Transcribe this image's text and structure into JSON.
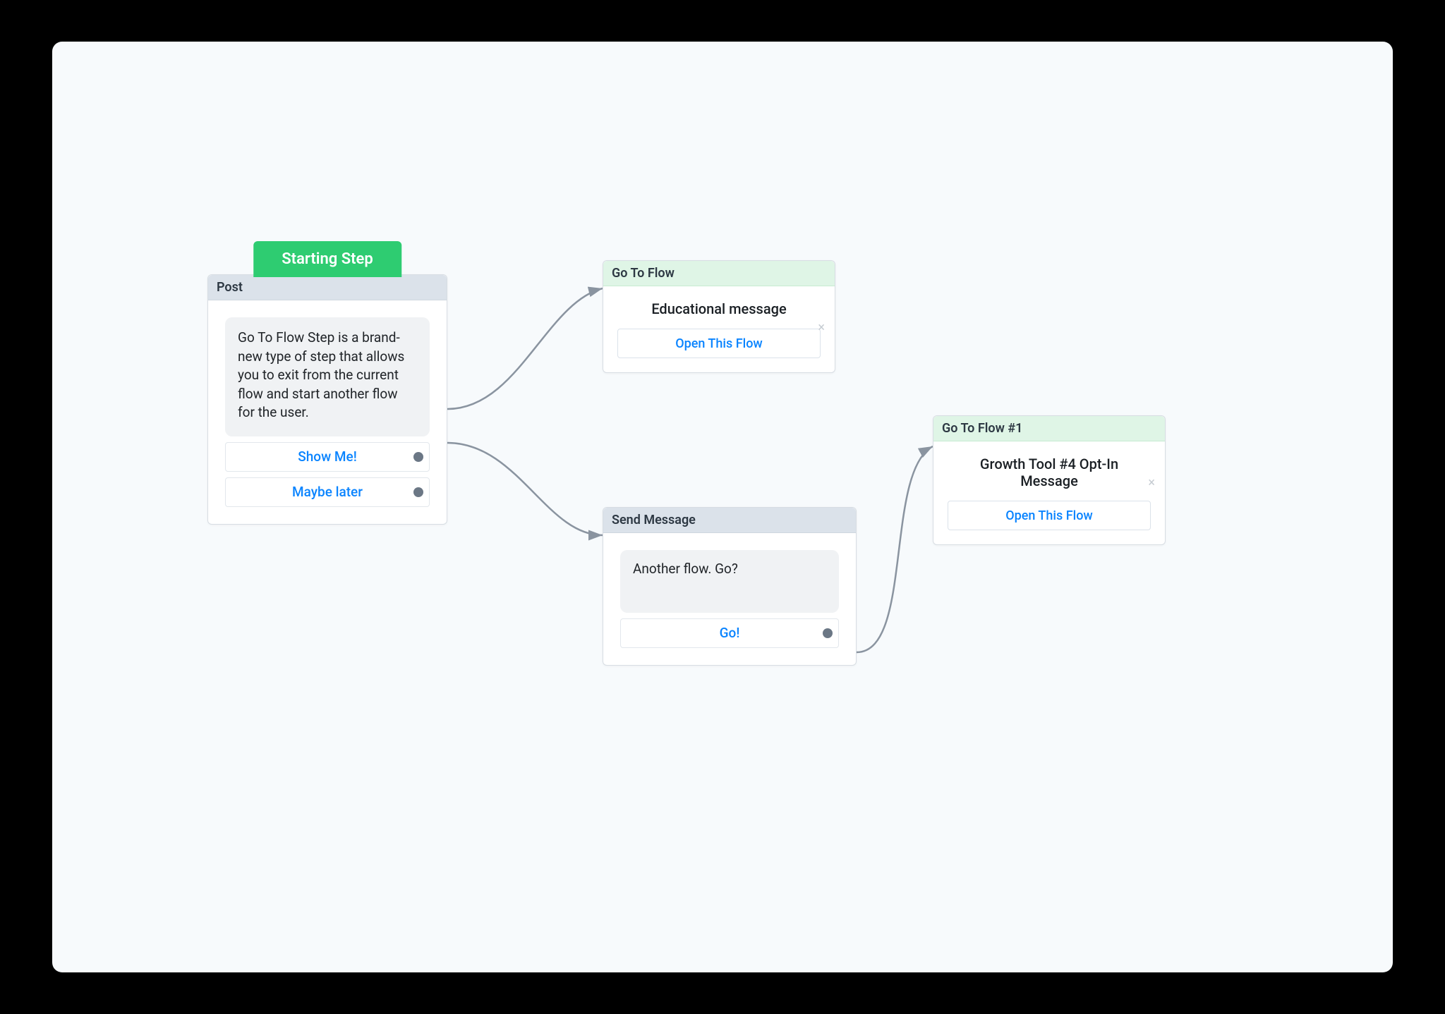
{
  "colors": {
    "accent_green": "#2ecc71",
    "link_blue": "#0a84ff",
    "port_gray": "#6b7785",
    "header_gray": "#dbe2ea",
    "header_green": "#dff5e6"
  },
  "starting_tag": "Starting Step",
  "nodes": {
    "post": {
      "title": "Post",
      "message": "Go To Flow Step is a brand-new type of step that allows you to exit from the current flow and start another flow for the user.",
      "choices": [
        {
          "label": "Show Me!"
        },
        {
          "label": "Maybe later"
        }
      ]
    },
    "goto1": {
      "title": "Go To Flow",
      "flow_name": "Educational message",
      "open_btn": "Open This Flow"
    },
    "send": {
      "title": "Send Message",
      "message": "Another flow. Go?",
      "choices": [
        {
          "label": "Go!"
        }
      ]
    },
    "goto2": {
      "title": "Go To Flow #1",
      "flow_name": "Growth Tool #4 Opt-In Message",
      "open_btn": "Open This Flow"
    }
  }
}
